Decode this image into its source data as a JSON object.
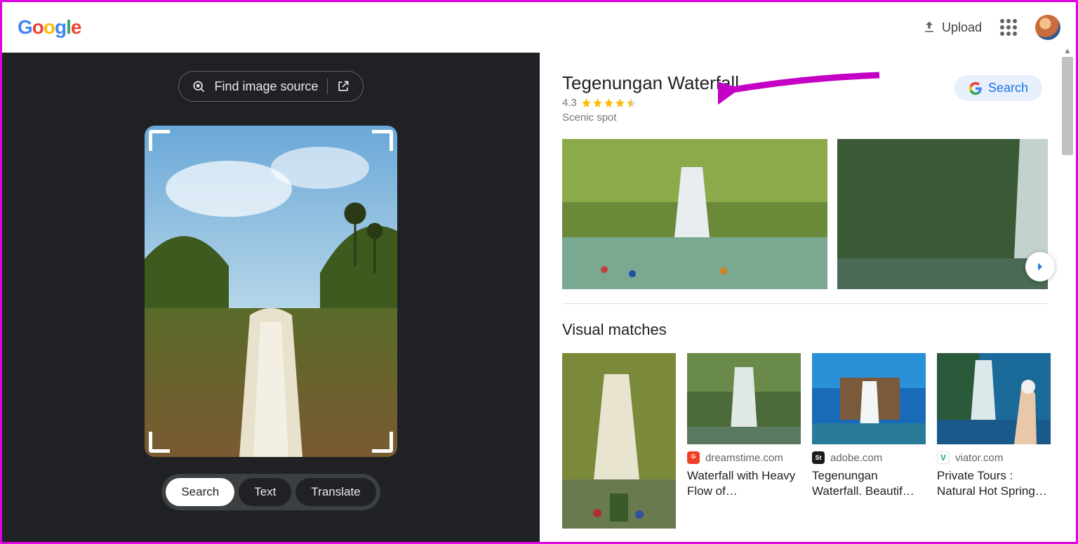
{
  "header": {
    "logo_text": "Google",
    "upload_label": "Upload"
  },
  "left_pane": {
    "find_source_label": "Find image source",
    "mode_tabs": [
      "Search",
      "Text",
      "Translate"
    ],
    "active_tab_index": 0
  },
  "knowledge_panel": {
    "title": "Tegenungan Waterfall",
    "rating_value": "4.3",
    "rating_stars": 4.5,
    "subtitle": "Scenic spot",
    "search_chip_label": "Search"
  },
  "visual_matches": {
    "heading": "Visual matches",
    "items": [
      {
        "source": "",
        "favicon_bg": "",
        "title": ""
      },
      {
        "source": "dreamstime.com",
        "favicon_bg": "#ef4023",
        "favicon_letter": "G",
        "title": "Waterfall with Heavy Flow of…"
      },
      {
        "source": "adobe.com",
        "favicon_bg": "#1a1a1a",
        "favicon_letter": "St",
        "title": "Tegenungan Waterfall. Beautif…"
      },
      {
        "source": "viator.com",
        "favicon_bg": "#fff",
        "favicon_fg": "#1aa783",
        "favicon_letter": "V",
        "title": "Private Tours : Natural Hot Spring…"
      }
    ]
  }
}
